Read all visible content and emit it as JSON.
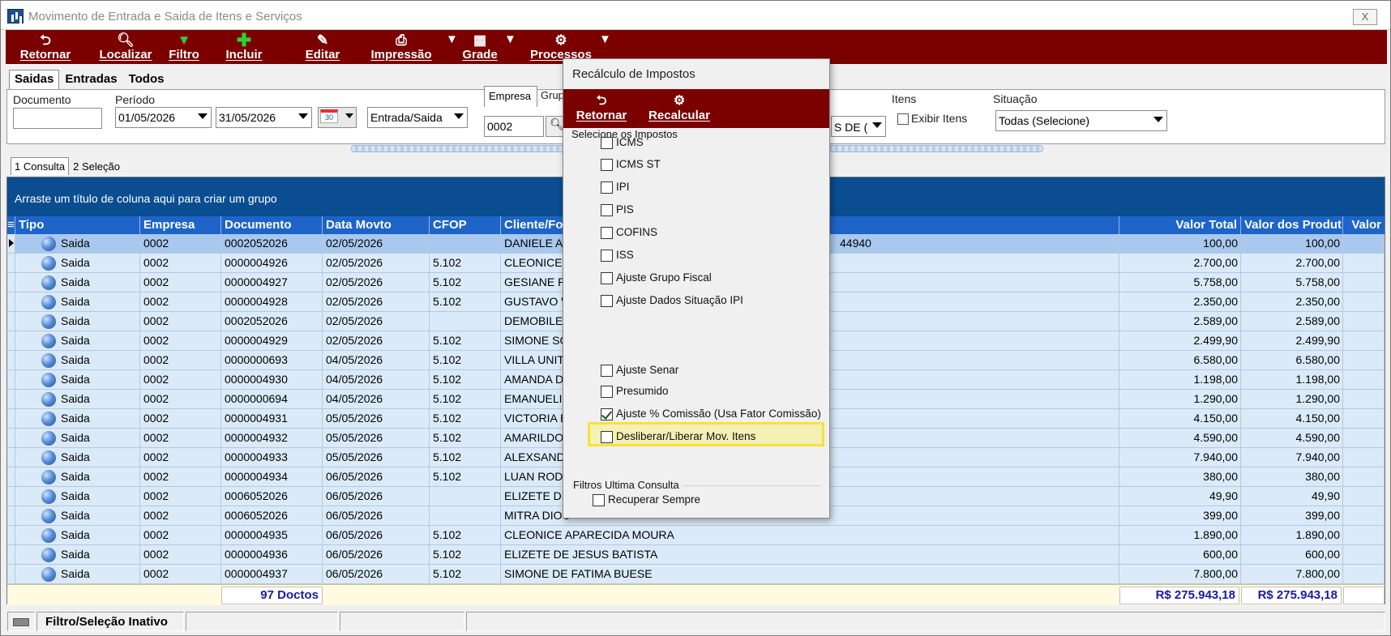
{
  "window": {
    "title": "Movimento de Entrada e Saida de Itens e Serviços",
    "close_label": "X"
  },
  "toolbar": {
    "retornar": "Retornar",
    "localizar": "Localizar",
    "filtro": "Filtro",
    "incluir": "Incluir",
    "editar": "Editar",
    "impressao": "Impressão",
    "grade": "Grade",
    "processos": "Processos",
    "dropdown_arrow": "▼"
  },
  "tabs": [
    "Saidas",
    "Entradas",
    "Todos"
  ],
  "filters": {
    "documento_label": "Documento",
    "documento_value": "",
    "periodo_label": "Período",
    "date_from": "01/05/2026",
    "date_to": "31/05/2026",
    "calendar_label": "30",
    "tipo_value": "Entrada/Saida",
    "empresa_label": "Empresa",
    "empresa_value": "0002",
    "grupo_label": "Grup",
    "grupo_value": "S DE (",
    "itens_label": "Itens",
    "exibir_itens": "Exibir Itens",
    "situacao_label": "Situação",
    "situacao_value": "Todas (Selecione)"
  },
  "subtabs": [
    "1 Consulta",
    "2 Seleção"
  ],
  "grid": {
    "group_hint": "Arraste um título de coluna aqui para criar um grupo",
    "columns": [
      "Tipo",
      "Empresa",
      "Documento",
      "Data Movto",
      "CFOP",
      "Cliente/For",
      "Valor Total",
      "Valor dos Produt",
      "Valor"
    ],
    "rows": [
      {
        "tipo": "Saida",
        "empresa": "0002",
        "documento": "0002052026",
        "data": "02/05/2026",
        "cfop": "",
        "cliente": "DANIELE AP",
        "extra": "44940",
        "total": "100,00",
        "produtos": "100,00"
      },
      {
        "tipo": "Saida",
        "empresa": "0002",
        "documento": "0000004926",
        "data": "02/05/2026",
        "cfop": "5.102",
        "cliente": "CLEONICE A",
        "extra": "",
        "total": "2.700,00",
        "produtos": "2.700,00"
      },
      {
        "tipo": "Saida",
        "empresa": "0002",
        "documento": "0000004927",
        "data": "02/05/2026",
        "cfop": "5.102",
        "cliente": "GESIANE PA",
        "extra": "",
        "total": "5.758,00",
        "produtos": "5.758,00"
      },
      {
        "tipo": "Saida",
        "empresa": "0002",
        "documento": "0000004928",
        "data": "02/05/2026",
        "cfop": "5.102",
        "cliente": "GUSTAVO W",
        "extra": "",
        "total": "2.350,00",
        "produtos": "2.350,00"
      },
      {
        "tipo": "Saida",
        "empresa": "0002",
        "documento": "0002052026",
        "data": "02/05/2026",
        "cfop": "",
        "cliente": "DEMOBILE -",
        "extra": "",
        "total": "2.589,00",
        "produtos": "2.589,00"
      },
      {
        "tipo": "Saida",
        "empresa": "0002",
        "documento": "0000004929",
        "data": "02/05/2026",
        "cfop": "5.102",
        "cliente": "SIMONE SOE",
        "extra": "",
        "total": "2.499,90",
        "produtos": "2.499,90"
      },
      {
        "tipo": "Saida",
        "empresa": "0002",
        "documento": "0000000693",
        "data": "04/05/2026",
        "cfop": "5.102",
        "cliente": "VILLA UNITE",
        "extra": "",
        "total": "6.580,00",
        "produtos": "6.580,00"
      },
      {
        "tipo": "Saida",
        "empresa": "0002",
        "documento": "0000004930",
        "data": "04/05/2026",
        "cfop": "5.102",
        "cliente": "AMANDA DE",
        "extra": "",
        "total": "1.198,00",
        "produtos": "1.198,00"
      },
      {
        "tipo": "Saida",
        "empresa": "0002",
        "documento": "0000000694",
        "data": "04/05/2026",
        "cfop": "5.102",
        "cliente": "EMANUELI A",
        "extra": "",
        "total": "1.290,00",
        "produtos": "1.290,00"
      },
      {
        "tipo": "Saida",
        "empresa": "0002",
        "documento": "0000004931",
        "data": "05/05/2026",
        "cfop": "5.102",
        "cliente": "VICTORIA BE",
        "extra": "",
        "total": "4.150,00",
        "produtos": "4.150,00"
      },
      {
        "tipo": "Saida",
        "empresa": "0002",
        "documento": "0000004932",
        "data": "05/05/2026",
        "cfop": "5.102",
        "cliente": "AMARILDO N",
        "extra": "",
        "total": "4.590,00",
        "produtos": "4.590,00"
      },
      {
        "tipo": "Saida",
        "empresa": "0002",
        "documento": "0000004933",
        "data": "05/05/2026",
        "cfop": "5.102",
        "cliente": "ALEXSANDR",
        "extra": "",
        "total": "7.940,00",
        "produtos": "7.940,00"
      },
      {
        "tipo": "Saida",
        "empresa": "0002",
        "documento": "0000004934",
        "data": "06/05/2026",
        "cfop": "5.102",
        "cliente": "LUAN RODE",
        "extra": "",
        "total": "380,00",
        "produtos": "380,00"
      },
      {
        "tipo": "Saida",
        "empresa": "0002",
        "documento": "0006052026",
        "data": "06/05/2026",
        "cfop": "",
        "cliente": "ELIZETE DE",
        "extra": "",
        "total": "49,90",
        "produtos": "49,90"
      },
      {
        "tipo": "Saida",
        "empresa": "0002",
        "documento": "0006052026",
        "data": "06/05/2026",
        "cfop": "",
        "cliente": "MITRA DIOC",
        "extra": "",
        "total": "399,00",
        "produtos": "399,00"
      },
      {
        "tipo": "Saida",
        "empresa": "0002",
        "documento": "0000004935",
        "data": "06/05/2026",
        "cfop": "5.102",
        "cliente": "CLEONICE APARECIDA MOURA",
        "extra": "",
        "total": "1.890,00",
        "produtos": "1.890,00"
      },
      {
        "tipo": "Saida",
        "empresa": "0002",
        "documento": "0000004936",
        "data": "06/05/2026",
        "cfop": "5.102",
        "cliente": "ELIZETE DE JESUS BATISTA",
        "extra": "",
        "total": "600,00",
        "produtos": "600,00"
      },
      {
        "tipo": "Saida",
        "empresa": "0002",
        "documento": "0000004937",
        "data": "06/05/2026",
        "cfop": "5.102",
        "cliente": "SIMONE DE FATIMA BUESE",
        "extra": "",
        "total": "7.800,00",
        "produtos": "7.800,00"
      }
    ],
    "footer": {
      "count": "97 Doctos",
      "total": "R$ 275.943,18",
      "produtos": "R$ 275.943,18"
    }
  },
  "statusbar": {
    "filter_status": "Filtro/Seleção Inativo"
  },
  "dialog": {
    "title": "Recálculo de Impostos",
    "retornar": "Retornar",
    "recalcular": "Recalcular",
    "section_impostos": "Selecione os Impostos",
    "items": [
      {
        "label": "ICMS",
        "checked": false
      },
      {
        "label": "ICMS ST",
        "checked": false
      },
      {
        "label": "IPI",
        "checked": false
      },
      {
        "label": "PIS",
        "checked": false
      },
      {
        "label": "COFINS",
        "checked": false
      },
      {
        "label": "ISS",
        "checked": false
      },
      {
        "label": "Ajuste Grupo Fiscal",
        "checked": false
      },
      {
        "label": "Ajuste Dados Situação IPI",
        "checked": false
      },
      {
        "label": "Ajuste Senar",
        "checked": false
      },
      {
        "label": "Presumido",
        "checked": false
      },
      {
        "label": "Ajuste % Comissão (Usa Fator Comissão)",
        "checked": true
      },
      {
        "label": "Desliberar/Liberar Mov. Itens",
        "checked": false
      }
    ],
    "section_filtros": "Filtros Ultima Consulta",
    "recuperar_sempre": "Recuperar Sempre"
  },
  "colors": {
    "toolbar": "#7b0000",
    "grid_header": "#1e64c8",
    "group_bar": "#0a4d91",
    "row": "#dbeaf8",
    "row_selected": "#a9c8ee",
    "highlight": "#f5e33a"
  }
}
